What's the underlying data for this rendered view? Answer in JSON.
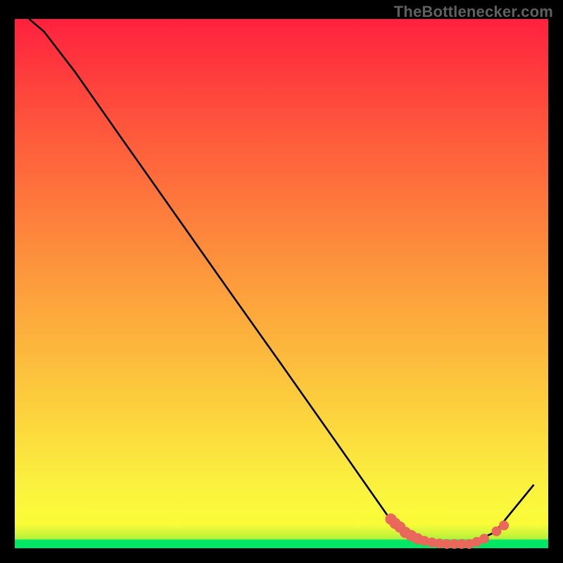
{
  "attribution": "TheBottlenecker.com",
  "chart_data": {
    "type": "line",
    "title": "",
    "xlabel": "",
    "ylabel": "",
    "xlim": [
      0,
      100
    ],
    "ylim": [
      0,
      100
    ],
    "background_gradient_stops": [
      {
        "offset": 0,
        "color": "#00e765"
      },
      {
        "offset": 0.015,
        "color": "#00e765"
      },
      {
        "offset": 0.018,
        "color": "#b7f13b"
      },
      {
        "offset": 0.045,
        "color": "#fafc37"
      },
      {
        "offset": 0.1,
        "color": "#fbf53e"
      },
      {
        "offset": 0.5,
        "color": "#fd9c3c"
      },
      {
        "offset": 0.78,
        "color": "#fe5a3c"
      },
      {
        "offset": 1.0,
        "color": "#ff213e"
      }
    ],
    "series": [
      {
        "name": "curve",
        "color": "#000000",
        "x": [
          2.7,
          5.5,
          11.3,
          20.0,
          30.0,
          40.0,
          50.0,
          60.0,
          70.0,
          73.0,
          76.0,
          80.0,
          85.0,
          90.0,
          97.3
        ],
        "y": [
          100.0,
          97.6,
          90.0,
          77.5,
          63.2,
          48.9,
          34.7,
          20.4,
          6.0,
          3.0,
          1.5,
          0.8,
          0.8,
          3.0,
          12.0
        ]
      }
    ],
    "markers": {
      "name": "highlight-dots",
      "color": "#e9675b",
      "x": [
        70.5,
        71.3,
        72.2,
        73.2,
        74.3,
        75.5,
        76.8,
        78.2,
        79.6,
        81.0,
        82.4,
        83.8,
        85.2,
        86.6,
        88.0,
        90.3,
        91.7
      ],
      "y": [
        5.5,
        4.7,
        4.0,
        3.0,
        2.4,
        1.8,
        1.4,
        1.1,
        0.9,
        0.8,
        0.8,
        0.8,
        0.8,
        1.2,
        1.8,
        3.2,
        4.3
      ],
      "r": [
        8,
        8,
        8,
        8,
        8,
        8,
        7,
        7,
        7,
        7,
        7,
        7,
        7,
        7,
        7,
        7,
        7
      ]
    }
  }
}
